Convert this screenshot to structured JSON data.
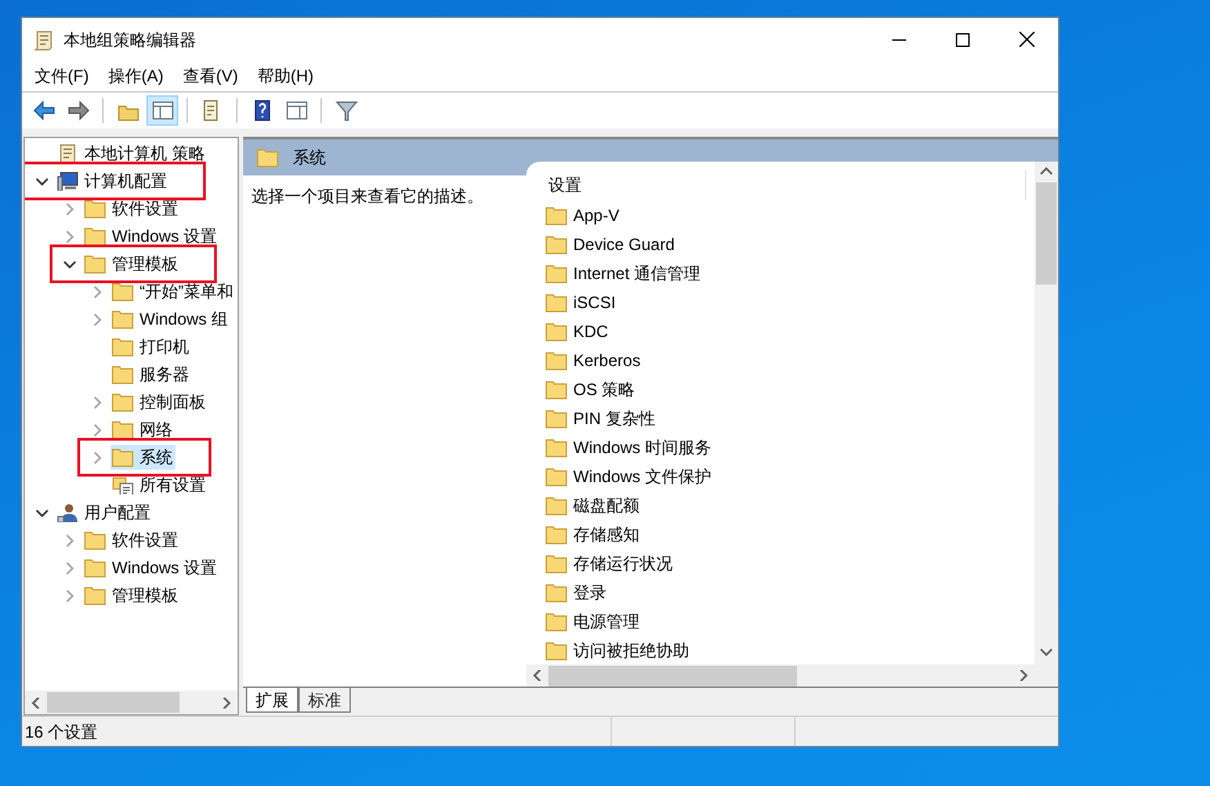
{
  "window": {
    "title": "本地组策略编辑器"
  },
  "menu": [
    {
      "label": "文件(F)"
    },
    {
      "label": "操作(A)"
    },
    {
      "label": "查看(V)"
    },
    {
      "label": "帮助(H)"
    }
  ],
  "toolbar": [
    {
      "kind": "back",
      "pressed": false
    },
    {
      "kind": "forward",
      "pressed": false
    },
    {
      "kind": "separator"
    },
    {
      "kind": "up",
      "pressed": false
    },
    {
      "kind": "tree",
      "pressed": true
    },
    {
      "kind": "separator"
    },
    {
      "kind": "export",
      "pressed": false
    },
    {
      "kind": "separator"
    },
    {
      "kind": "help",
      "pressed": false
    },
    {
      "kind": "panel",
      "pressed": false
    },
    {
      "kind": "separator"
    },
    {
      "kind": "filter",
      "pressed": false
    }
  ],
  "tree": {
    "items": [
      {
        "label": "本地计算机 策略",
        "kind": "policy",
        "selected": false,
        "highlighted": false,
        "children": [
          {
            "label": "计算机配置",
            "kind": "computer",
            "expanded": true,
            "selected": false,
            "highlighted": true,
            "children": [
              {
                "label": "软件设置",
                "kind": "folder",
                "expanded": false,
                "selected": false,
                "highlighted": false
              },
              {
                "label": "Windows 设置",
                "kind": "folder",
                "expanded": false,
                "selected": false,
                "highlighted": false
              },
              {
                "label": "管理模板",
                "kind": "folder",
                "expanded": true,
                "selected": false,
                "highlighted": true,
                "children": [
                  {
                    "label": "“开始”菜单和",
                    "kind": "folder",
                    "expanded": false,
                    "selected": false,
                    "highlighted": false
                  },
                  {
                    "label": "Windows 组",
                    "kind": "folder",
                    "expanded": false,
                    "selected": false,
                    "highlighted": false
                  },
                  {
                    "label": "打印机",
                    "kind": "folder",
                    "selected": false,
                    "highlighted": false
                  },
                  {
                    "label": "服务器",
                    "kind": "folder",
                    "selected": false,
                    "highlighted": false
                  },
                  {
                    "label": "控制面板",
                    "kind": "folder",
                    "expanded": false,
                    "selected": false,
                    "highlighted": false
                  },
                  {
                    "label": "网络",
                    "kind": "folder",
                    "expanded": false,
                    "selected": false,
                    "highlighted": false
                  },
                  {
                    "label": "系统",
                    "kind": "folder",
                    "expanded": false,
                    "selected": true,
                    "highlighted": true
                  },
                  {
                    "label": "所有设置",
                    "kind": "settings",
                    "selected": false,
                    "highlighted": false
                  }
                ]
              }
            ]
          },
          {
            "label": "用户配置",
            "kind": "user",
            "expanded": true,
            "selected": false,
            "highlighted": false,
            "children": [
              {
                "label": "软件设置",
                "kind": "folder",
                "expanded": false,
                "selected": false,
                "highlighted": false
              },
              {
                "label": "Windows 设置",
                "kind": "folder",
                "expanded": false,
                "selected": false,
                "highlighted": false
              },
              {
                "label": "管理模板",
                "kind": "folder",
                "expanded": false,
                "selected": false,
                "highlighted": false
              }
            ]
          }
        ]
      }
    ]
  },
  "details": {
    "header": "系统",
    "description": "选择一个项目来查看它的描述。",
    "list_heading": "设置",
    "items": [
      {
        "label": "App-V"
      },
      {
        "label": "Device Guard"
      },
      {
        "label": "Internet 通信管理"
      },
      {
        "label": "iSCSI"
      },
      {
        "label": "KDC"
      },
      {
        "label": "Kerberos"
      },
      {
        "label": "OS 策略"
      },
      {
        "label": "PIN 复杂性"
      },
      {
        "label": "Windows 时间服务"
      },
      {
        "label": "Windows 文件保护"
      },
      {
        "label": "磁盘配额"
      },
      {
        "label": "存储感知"
      },
      {
        "label": "存储运行状况"
      },
      {
        "label": "登录"
      },
      {
        "label": "电源管理"
      },
      {
        "label": "访问被拒绝协助"
      }
    ]
  },
  "tabs": [
    {
      "label": "扩展",
      "selected": true
    },
    {
      "label": "标准",
      "selected": false
    }
  ],
  "status_bar": "16 个设置"
}
